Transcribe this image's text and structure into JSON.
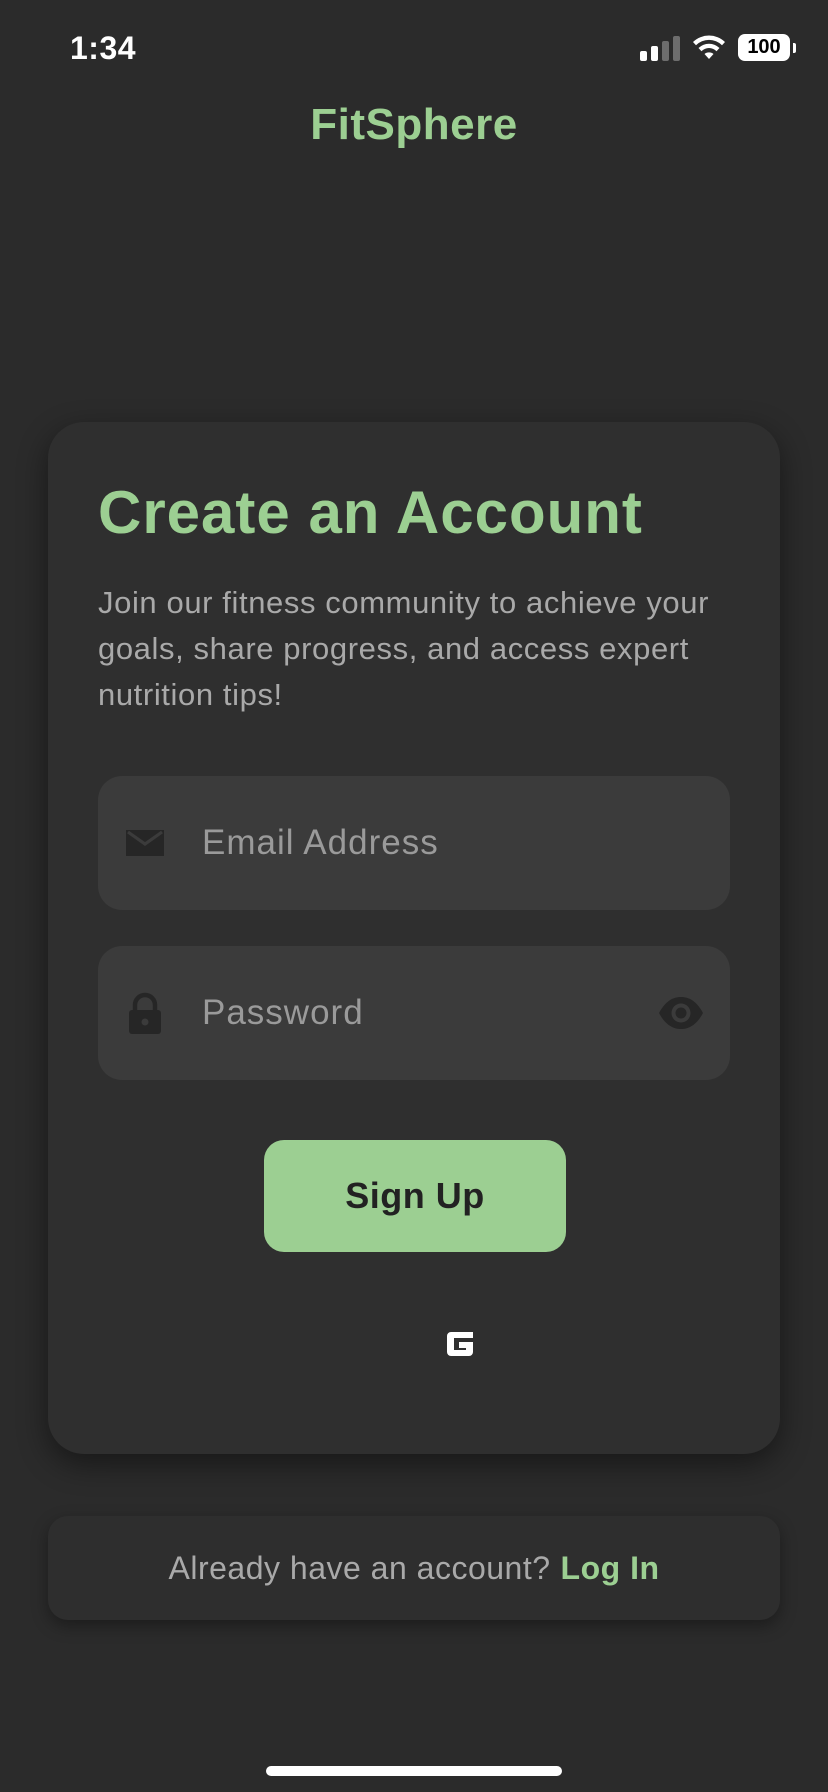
{
  "status_bar": {
    "time": "1:34",
    "battery": "100",
    "icons": [
      "signal-icon",
      "wifi-icon",
      "battery-icon"
    ]
  },
  "app": {
    "name": "FitSphere"
  },
  "card": {
    "title": "Create an Account",
    "subtitle": "Join our fitness community to achieve your goals, share progress, and access expert nutrition tips!",
    "email": {
      "placeholder": "Email Address",
      "value": "",
      "icon": "mail-icon"
    },
    "password": {
      "placeholder": "Password",
      "value": "",
      "icon": "lock-icon",
      "toggle_icon": "eye-icon"
    },
    "signup_label": "Sign Up",
    "google_icon": "google-icon"
  },
  "login_prompt": {
    "text": "Already have an account?",
    "link_label": "Log In"
  },
  "colors": {
    "background": "#2b2b2b",
    "card": "#2f2f2f",
    "field": "#3b3b3b",
    "accent": "#9ccf92",
    "muted_text": "#a9a9a9"
  }
}
